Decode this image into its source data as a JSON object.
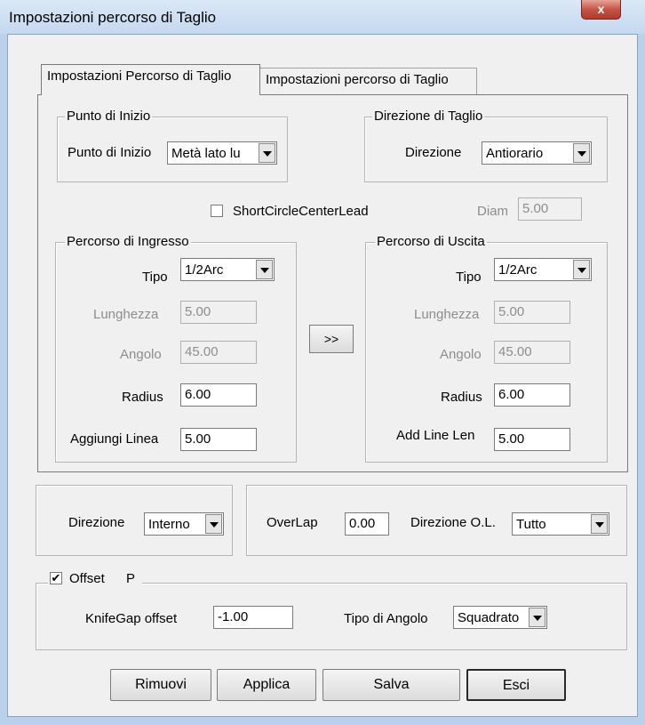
{
  "window": {
    "title": "Impostazioni percorso di Taglio",
    "close_glyph": "x"
  },
  "tabs": [
    {
      "label": "Impostazioni Percorso di Taglio",
      "active": true
    },
    {
      "label": "Impostazioni percorso di Taglio",
      "active": false
    }
  ],
  "start_point": {
    "group_title": "Punto di Inizio",
    "label": "Punto di Inizio",
    "value": "Metà lato lu"
  },
  "cut_direction": {
    "group_title": "Direzione di Taglio",
    "label": "Direzione",
    "value": "Antiorario"
  },
  "short_circle": {
    "label": "ShortCircleCenterLead",
    "checked": false,
    "diam_label": "Diam",
    "diam_value": "5.00"
  },
  "lead_in": {
    "group_title": "Percorso di Ingresso",
    "type_label": "Tipo",
    "type_value": "1/2Arc",
    "length_label": "Lunghezza",
    "length_value": "5.00",
    "angle_label": "Angolo",
    "angle_value": "45.00",
    "radius_label": "Radius",
    "radius_value": "6.00",
    "add_line_label": "Aggiungi Linea",
    "add_line_value": "5.00"
  },
  "copy_button": {
    "label": ">>"
  },
  "lead_out": {
    "group_title": "Percorso di Uscita",
    "type_label": "Tipo",
    "type_value": "1/2Arc",
    "length_label": "Lunghezza",
    "length_value": "5.00",
    "angle_label": "Angolo",
    "angle_value": "45.00",
    "radius_label": "Radius",
    "radius_value": "6.00",
    "add_line_label": "Add Line Len",
    "add_line_value": "5.00"
  },
  "direction": {
    "label": "Direzione",
    "value": "Interno"
  },
  "overlap": {
    "label": "OverLap",
    "value": "0.00",
    "direction_label": "Direzione O.L.",
    "direction_value": "Tutto"
  },
  "offset": {
    "checkbox_label": "Offset",
    "checked": true,
    "checkbox_glyph": "✔",
    "extra_label": "P",
    "knifegap_label": "KnifeGap offset",
    "knifegap_value": "-1.00",
    "corner_label": "Tipo di Angolo",
    "corner_value": "Squadrato"
  },
  "buttons": {
    "remove": "Rimuovi",
    "apply": "Applica",
    "save": "Salva",
    "exit": "Esci"
  }
}
